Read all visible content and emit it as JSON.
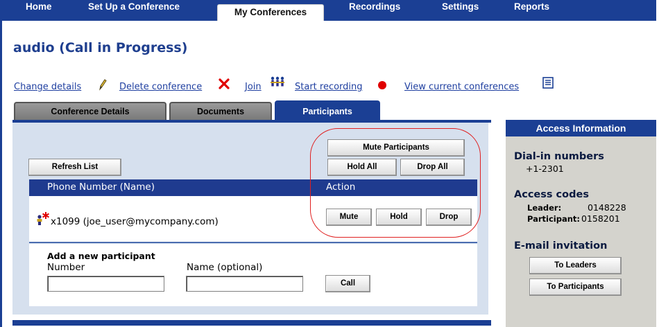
{
  "nav": {
    "tabs": [
      {
        "label": "Home"
      },
      {
        "label": "Set Up a Conference"
      },
      {
        "label": "My Conferences"
      },
      {
        "label": "Recordings"
      },
      {
        "label": "Settings"
      },
      {
        "label": "Reports"
      }
    ],
    "active": "My Conferences"
  },
  "page": {
    "title": "audio (Call in Progress)"
  },
  "actions": {
    "change_details": "Change details",
    "delete_conference": "Delete conference",
    "join": "Join",
    "start_recording": "Start recording",
    "view_current": "View current conferences"
  },
  "tabs": {
    "conference_details": "Conference Details",
    "documents": "Documents",
    "participants": "Participants"
  },
  "participants": {
    "refresh_label": "Refresh List",
    "mute_participants_label": "Mute Participants",
    "hold_all_label": "Hold All",
    "drop_all_label": "Drop All",
    "col_phone": "Phone Number (Name)",
    "col_action": "Action",
    "rows": [
      {
        "phone": "x1099 (joe_user@mycompany.com)",
        "mute": "Mute",
        "hold": "Hold",
        "drop": "Drop"
      }
    ],
    "add": {
      "heading": "Add a new participant",
      "number_label": "Number",
      "name_label": "Name (optional)",
      "number_value": "",
      "name_value": "",
      "call_label": "Call"
    }
  },
  "access": {
    "header": "Access Information",
    "dialin_heading": "Dial-in numbers",
    "dialin_number": "+1-2301",
    "codes_heading": "Access codes",
    "leader_label": "Leader:",
    "leader_code": "0148228",
    "participant_label": "Participant:",
    "participant_code": "0158201",
    "email_heading": "E-mail invitation",
    "to_leaders": "To Leaders",
    "to_participants": "To Participants"
  },
  "colors": {
    "nav_blue": "#1b3f94",
    "title_blue": "#1f3f8f",
    "highlight_red": "#e02020",
    "record_red": "#e00000"
  },
  "icons": [
    "pencil-icon",
    "delete-x-icon",
    "join-people-icon",
    "record-dot-icon",
    "list-document-icon",
    "participant-leader-icon"
  ]
}
